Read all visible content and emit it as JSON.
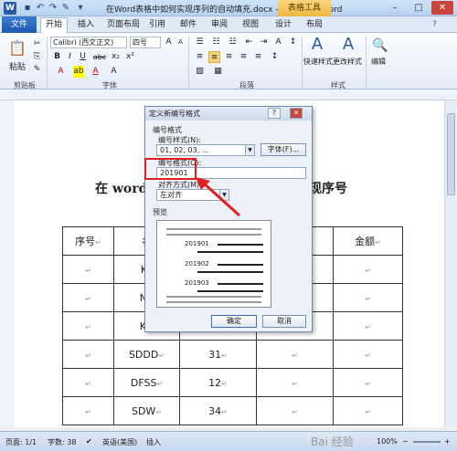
{
  "window": {
    "title": "在Word表格中如何实现序列的自动填充.docx - Microsoft Word",
    "word_icon": "W",
    "context_tab": "表格工具",
    "controls": {
      "minimize": "–",
      "maximize": "□",
      "close": "✕"
    }
  },
  "tabs": [
    "文件",
    "开始",
    "插入",
    "页面布局",
    "引用",
    "邮件",
    "审阅",
    "视图",
    "设计",
    "布局"
  ],
  "ribbon": {
    "clipboard": {
      "label": "剪贴板",
      "paste": "粘贴"
    },
    "font": {
      "label": "字体",
      "font_name": "Calibri (西文正文)",
      "font_size": "四号",
      "grow": "A",
      "shrink": "A",
      "bold": "B",
      "italic": "I",
      "underline": "U",
      "strike": "abc",
      "sub": "x₂",
      "sup": "x²",
      "clear": "A",
      "color": "A",
      "char_border": "A"
    },
    "paragraph": {
      "label": "段落"
    },
    "styles": {
      "label": "样式",
      "quick": "快速样式",
      "change": "更改样式"
    },
    "editing": {
      "label": "编辑"
    }
  },
  "document": {
    "heading_left": "在 word",
    "heading_right": "现序号",
    "table": {
      "header": [
        "序号",
        "名",
        "",
        "",
        "金额"
      ],
      "rows": [
        [
          "",
          "KL",
          "",
          "",
          ""
        ],
        [
          "",
          "NK",
          "",
          "",
          ""
        ],
        [
          "",
          "KH",
          "",
          "",
          ""
        ],
        [
          "",
          "SDDD",
          "31",
          "",
          ""
        ],
        [
          "",
          "DFSS",
          "12",
          "",
          ""
        ],
        [
          "",
          "SDW",
          "34",
          "",
          ""
        ]
      ]
    },
    "return_mark": "↵"
  },
  "dialog": {
    "title": "定义新编号格式",
    "help": "?",
    "close": "✕",
    "section": "编号格式",
    "style_label": "编号样式(N):",
    "style_value": "01, 02, 03, ...",
    "font_button": "字体(F)...",
    "format_label": "编号格式(O):",
    "format_value": "201901",
    "align_label": "对齐方式(M):",
    "align_value": "左对齐",
    "preview_label": "预览",
    "preview_items": [
      "201901",
      "201902",
      "201903"
    ],
    "ok": "确定",
    "cancel": "取消"
  },
  "status": {
    "page": "页面: 1/1",
    "words": "字数: 38",
    "lang": "英语(美国)",
    "mode": "插入",
    "zoom": "100%",
    "watermark": "Bai 经验"
  },
  "colors": {
    "accent": "#2a5aa8",
    "highlight": "#e02020"
  }
}
